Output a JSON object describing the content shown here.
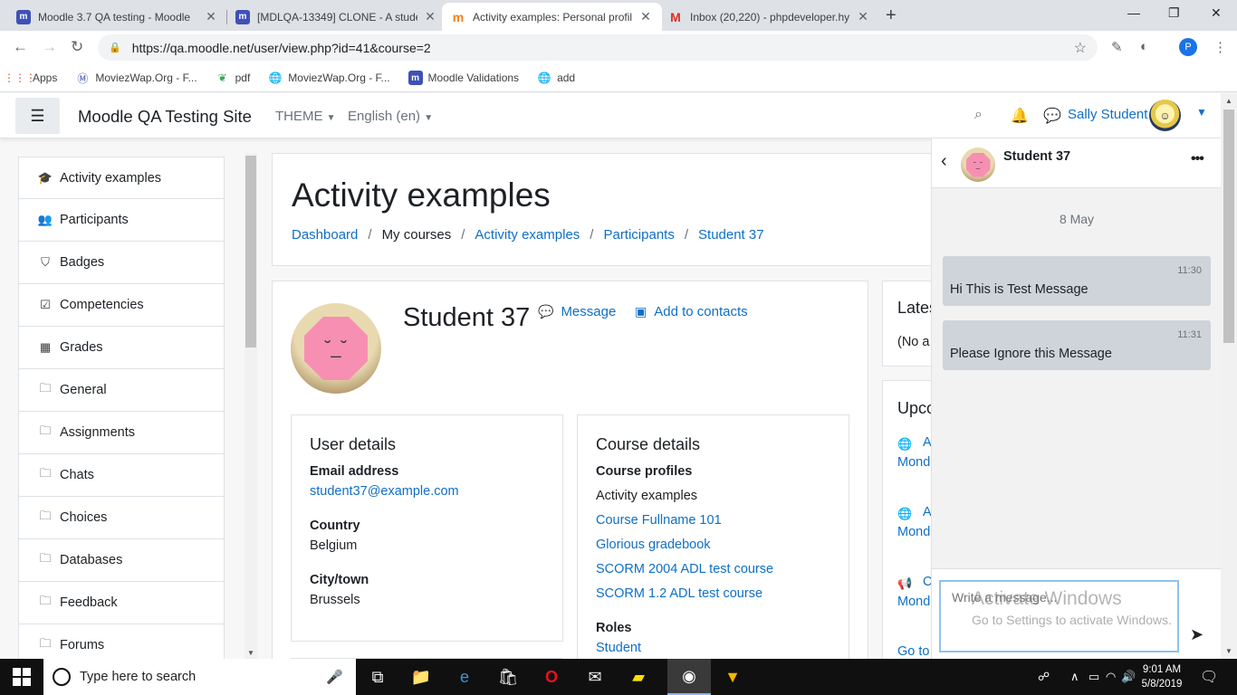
{
  "browser": {
    "tabs": [
      {
        "title": "Moodle 3.7 QA testing - Moodle",
        "icon": "moodle-m-icon"
      },
      {
        "title": "[MDLQA-13349] CLONE - A stude",
        "icon": "moodle-m-icon"
      },
      {
        "title": "Activity examples: Personal profil",
        "icon": "moodle-hat-icon"
      },
      {
        "title": "Inbox (20,220) - phpdeveloper.hy",
        "icon": "gmail-icon"
      }
    ],
    "active_tab": 2,
    "url": "https://qa.moodle.net/user/view.php?id=41&course=2",
    "profile_initial": "P",
    "bookmarks": [
      {
        "label": "Apps",
        "icon": "apps-grid-icon"
      },
      {
        "label": "MoviezWap.Org - F...",
        "icon": "moviezwap-icon"
      },
      {
        "label": "pdf",
        "icon": "leaf-icon"
      },
      {
        "label": "MoviezWap.Org - F...",
        "icon": "globe-icon"
      },
      {
        "label": "Moodle Validations",
        "icon": "moodle-m-icon"
      },
      {
        "label": "add",
        "icon": "globe-icon"
      }
    ]
  },
  "navbar": {
    "site_name": "Moodle QA Testing Site",
    "theme_label": "THEME",
    "language_label": "English (en)",
    "user_name": "Sally Student"
  },
  "drawer": {
    "items": [
      {
        "label": "Activity examples",
        "icon": "graduation-cap-icon"
      },
      {
        "label": "Participants",
        "icon": "users-icon"
      },
      {
        "label": "Badges",
        "icon": "shield-icon"
      },
      {
        "label": "Competencies",
        "icon": "checkbox-icon"
      },
      {
        "label": "Grades",
        "icon": "table-icon"
      },
      {
        "label": "General",
        "icon": "folder-icon"
      },
      {
        "label": "Assignments",
        "icon": "folder-icon"
      },
      {
        "label": "Chats",
        "icon": "folder-icon"
      },
      {
        "label": "Choices",
        "icon": "folder-icon"
      },
      {
        "label": "Databases",
        "icon": "folder-icon"
      },
      {
        "label": "Feedback",
        "icon": "folder-icon"
      },
      {
        "label": "Forums",
        "icon": "folder-icon"
      }
    ]
  },
  "page": {
    "title": "Activity examples",
    "breadcrumb": [
      "Dashboard",
      "My courses",
      "Activity examples",
      "Participants",
      "Student 37"
    ]
  },
  "profile": {
    "name": "Student 37",
    "message_label": "Message",
    "add_contact_label": "Add to contacts",
    "user_details": {
      "heading": "User details",
      "email_label": "Email address",
      "email": "student37@example.com",
      "country_label": "Country",
      "country": "Belgium",
      "city_label": "City/town",
      "city": "Brussels"
    },
    "course_details": {
      "heading": "Course details",
      "profiles_label": "Course profiles",
      "courses": [
        "Activity examples",
        "Course Fullname 101",
        "Glorious gradebook",
        "SCORM 2004 ADL test course",
        "SCORM 1.2 ADL test course"
      ],
      "roles_label": "Roles",
      "role": "Student"
    }
  },
  "right_blocks": {
    "latest_title": "Lates",
    "latest_text": "(No a",
    "upcoming_title": "Upco",
    "events": [
      {
        "first": "A",
        "second": "Mond"
      },
      {
        "first": "A",
        "second": "Mond"
      },
      {
        "first": "C",
        "second": "Mond"
      }
    ],
    "goto": "Go to"
  },
  "messaging": {
    "contact_name": "Student 37",
    "date": "8 May",
    "messages": [
      {
        "time": "11:30",
        "text": "Hi This is Test Message"
      },
      {
        "time": "11:31",
        "text": "Please Ignore this Message"
      }
    ],
    "input_placeholder": "Write a message..."
  },
  "windows": {
    "watermark_title": "Activate Windows",
    "watermark_sub": "Go to Settings to activate Windows.",
    "search_placeholder": "Type here to search",
    "time": "9:01 AM",
    "date": "5/8/2019"
  }
}
